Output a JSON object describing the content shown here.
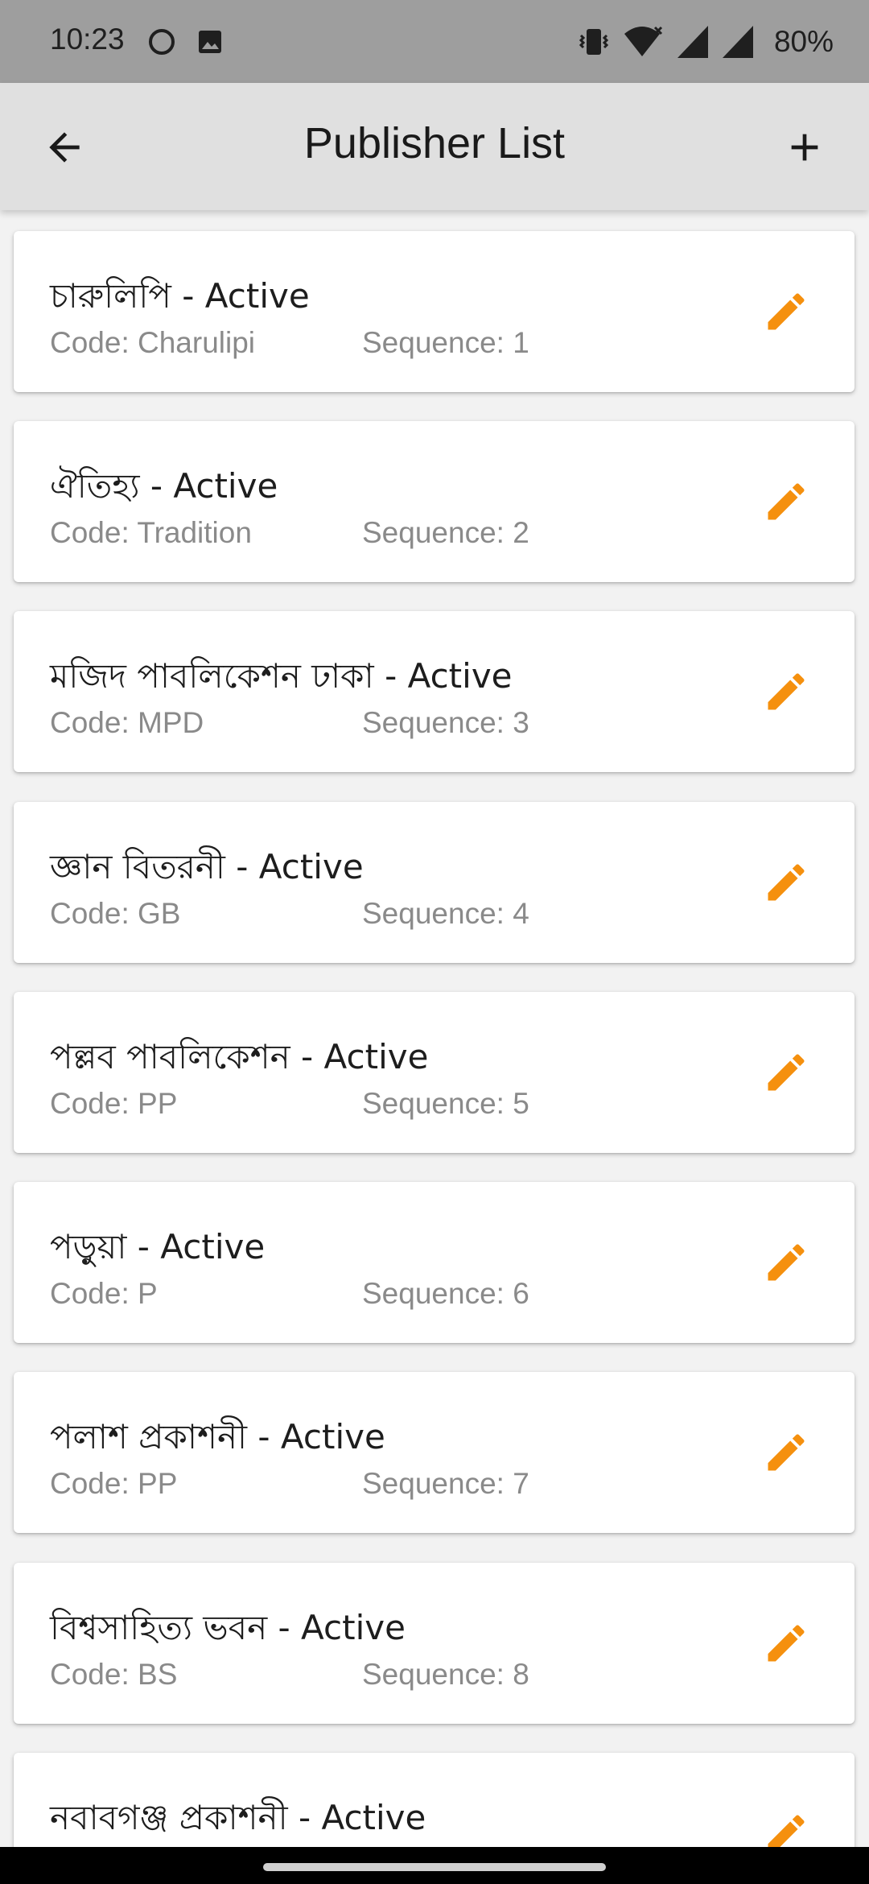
{
  "status_bar": {
    "time": "10:23",
    "battery": "80%",
    "icons": [
      "circle-notification-icon",
      "image-notification-icon",
      "vibrate-icon",
      "wifi-icon",
      "cell-signal-icon",
      "cell-signal-icon"
    ]
  },
  "app_bar": {
    "title": "Publisher List",
    "back_icon": "arrow-left-icon",
    "add_icon": "plus-icon"
  },
  "colors": {
    "app_bar_bg": "#e0e0e0",
    "status_bar_bg": "#9e9e9e",
    "edit_icon": "#f5900e",
    "secondary_text": "#8a8a8a"
  },
  "publishers": [
    {
      "title": "চারুলিপি - Active",
      "code": "Code: Charulipi",
      "sequence": "Sequence: 1"
    },
    {
      "title": "ঐতিহ্য - Active",
      "code": "Code: Tradition",
      "sequence": "Sequence: 2"
    },
    {
      "title": "মজিদ পাবলিকেশন ঢাকা - Active",
      "code": "Code: MPD",
      "sequence": "Sequence: 3"
    },
    {
      "title": "জ্ঞান বিতরনী - Active",
      "code": "Code: GB",
      "sequence": "Sequence: 4"
    },
    {
      "title": "পল্লব পাবলিকেশন - Active",
      "code": "Code: PP",
      "sequence": "Sequence: 5"
    },
    {
      "title": "পড়ুয়া - Active",
      "code": "Code: P",
      "sequence": "Sequence: 6"
    },
    {
      "title": "পলাশ প্রকাশনী - Active",
      "code": "Code: PP",
      "sequence": "Sequence: 7"
    },
    {
      "title": "বিশ্বসাহিত্য ভবন - Active",
      "code": "Code: BS",
      "sequence": "Sequence: 8"
    },
    {
      "title": "নবাবগঞ্জ প্রকাশনী - Active",
      "code": "",
      "sequence": ""
    }
  ]
}
